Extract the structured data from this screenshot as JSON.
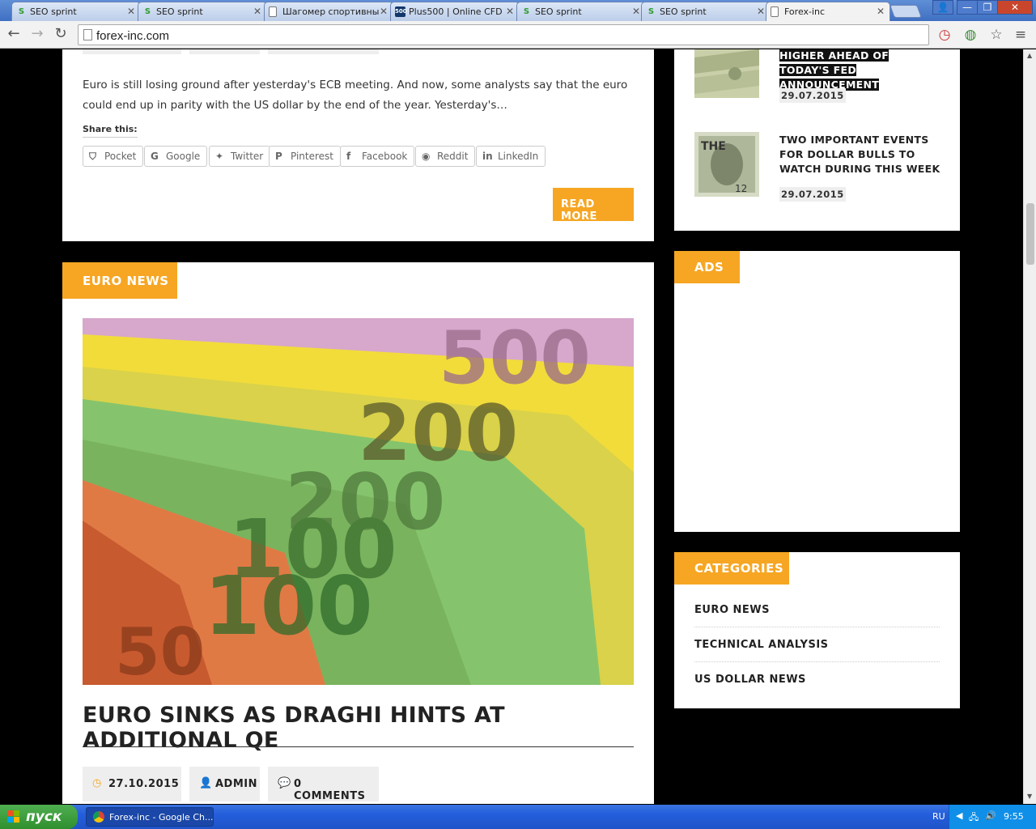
{
  "browser": {
    "tabs": [
      {
        "title": "SEO sprint",
        "icon": "seo-sprint-favicon"
      },
      {
        "title": "SEO sprint",
        "icon": "seo-sprint-favicon"
      },
      {
        "title": "Шагомер спортивны",
        "icon": "document-favicon"
      },
      {
        "title": "Plus500 | Online CFD",
        "icon": "plus500-favicon"
      },
      {
        "title": "SEO sprint",
        "icon": "seo-sprint-favicon"
      },
      {
        "title": "SEO sprint",
        "icon": "seo-sprint-favicon"
      },
      {
        "title": "Forex-inc",
        "icon": "document-favicon",
        "active": true
      }
    ],
    "url": "forex-inc.com"
  },
  "prev_post": {
    "excerpt": "Euro is still losing ground after yesterday's ECB meeting. And now, some analysts say that the euro could end up in parity with the US dollar by the end of the year. Yesterday's…",
    "share_label": "Share this:",
    "share_buttons": [
      "Pocket",
      "Google",
      "Twitter",
      "Pinterest",
      "Facebook",
      "Reddit",
      "LinkedIn"
    ],
    "read_more": "READ MORE"
  },
  "post": {
    "category": "EURO NEWS",
    "title": "EURO SINKS AS DRAGHI HINTS AT ADDITIONAL QE",
    "date": "27.10.2015",
    "author": "ADMIN",
    "comments": "0 COMMENTS"
  },
  "sidebar": {
    "recent": [
      {
        "title": "HIGHER AHEAD OF TODAY'S FED ANNOUNCEMENT",
        "date": "29.07.2015"
      },
      {
        "title": "TWO IMPORTANT EVENTS FOR DOLLAR BULLS TO WATCH DURING THIS WEEK",
        "date": "29.07.2015"
      }
    ],
    "ads_label": "ADS",
    "categories_label": "CATEGORIES",
    "categories": [
      "EURO NEWS",
      "TECHNICAL ANALYSIS",
      "US DOLLAR NEWS"
    ]
  },
  "taskbar": {
    "start_label": "пуск",
    "task": "Forex-inc - Google Ch...",
    "lang": "RU",
    "time": "9:55"
  },
  "colors": {
    "accent": "#f6a623"
  }
}
